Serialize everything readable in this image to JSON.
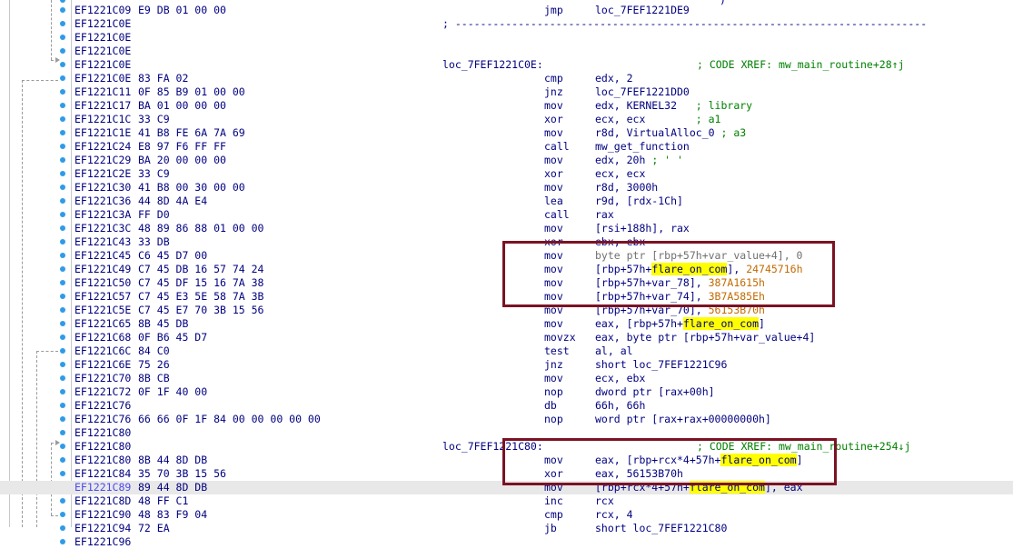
{
  "listing": {
    "top_fragment": {
      "text": ")"
    },
    "rows": [
      {
        "addr": "EF1221C09",
        "bytes": "E9 DB 01 00 00",
        "mnemonic": "jmp",
        "operand": [
          {
            "t": "loc_7FEF1221DE9"
          }
        ]
      },
      {
        "addr": "EF1221C0E",
        "separator": "; ---------------------------------------------------------------------------"
      },
      {
        "addr": "EF1221C0E"
      },
      {
        "addr": "EF1221C0E"
      },
      {
        "addr": "EF1221C0E",
        "label": "loc_7FEF1221C0E:",
        "xref": "; CODE XREF: mw_main_routine+28↑j"
      },
      {
        "addr": "EF1221C0E",
        "bytes": "83 FA 02",
        "mnemonic": "cmp",
        "operand": [
          {
            "t": "edx, 2"
          }
        ]
      },
      {
        "addr": "EF1221C11",
        "bytes": "0F 85 B9 01 00 00",
        "mnemonic": "jnz",
        "operand": [
          {
            "t": "loc_7FEF1221DD0"
          }
        ]
      },
      {
        "addr": "EF1221C17",
        "bytes": "BA 01 00 00 00",
        "mnemonic": "mov",
        "operand": [
          {
            "t": "edx, KERNEL32   "
          },
          {
            "t": "; library",
            "c": "cmt"
          }
        ]
      },
      {
        "addr": "EF1221C1C",
        "bytes": "33 C9",
        "mnemonic": "xor",
        "operand": [
          {
            "t": "ecx, ecx        "
          },
          {
            "t": "; a1",
            "c": "cmt"
          }
        ]
      },
      {
        "addr": "EF1221C1E",
        "bytes": "41 B8 FE 6A 7A 69",
        "mnemonic": "mov",
        "operand": [
          {
            "t": "r8d, VirtualAlloc_0 "
          },
          {
            "t": "; a3",
            "c": "cmt"
          }
        ]
      },
      {
        "addr": "EF1221C24",
        "bytes": "E8 97 F6 FF FF",
        "mnemonic": "call",
        "operand": [
          {
            "t": "mw_get_function"
          }
        ]
      },
      {
        "addr": "EF1221C29",
        "bytes": "BA 20 00 00 00",
        "mnemonic": "mov",
        "operand": [
          {
            "t": "edx, 20h "
          },
          {
            "t": "; ' '",
            "c": "cmt"
          }
        ]
      },
      {
        "addr": "EF1221C2E",
        "bytes": "33 C9",
        "mnemonic": "xor",
        "operand": [
          {
            "t": "ecx, ecx"
          }
        ]
      },
      {
        "addr": "EF1221C30",
        "bytes": "41 B8 00 30 00 00",
        "mnemonic": "mov",
        "operand": [
          {
            "t": "r8d, 3000h"
          }
        ]
      },
      {
        "addr": "EF1221C36",
        "bytes": "44 8D 4A E4",
        "mnemonic": "lea",
        "operand": [
          {
            "t": "r9d, [rdx-1Ch]"
          }
        ]
      },
      {
        "addr": "EF1221C3A",
        "bytes": "FF D0",
        "mnemonic": "call",
        "operand": [
          {
            "t": "rax"
          }
        ]
      },
      {
        "addr": "EF1221C3C",
        "bytes": "48 89 86 88 01 00 00",
        "mnemonic": "mov",
        "operand": [
          {
            "t": "[rsi+188h], rax"
          }
        ]
      },
      {
        "addr": "EF1221C43",
        "bytes": "33 DB",
        "mnemonic": "xor",
        "operand": [
          {
            "t": "ebx, ebx"
          }
        ]
      },
      {
        "addr": "EF1221C45",
        "bytes": "C6 45 D7 00",
        "mnemonic": "mov",
        "operand": [
          {
            "t": "byte ptr [rbp+57h+var_value+4], 0",
            "c": "gray"
          }
        ]
      },
      {
        "addr": "EF1221C49",
        "bytes": "C7 45 DB 16 57 74 24",
        "mnemonic": "mov",
        "operand": [
          {
            "t": "[rbp+57h+"
          },
          {
            "t": "flare_on_com",
            "c": "yel"
          },
          {
            "t": "], "
          },
          {
            "t": "24745716h",
            "c": "imm"
          }
        ]
      },
      {
        "addr": "EF1221C50",
        "bytes": "C7 45 DF 15 16 7A 38",
        "mnemonic": "mov",
        "operand": [
          {
            "t": "[rbp+57h+var_78], "
          },
          {
            "t": "387A1615h",
            "c": "imm"
          }
        ]
      },
      {
        "addr": "EF1221C57",
        "bytes": "C7 45 E3 5E 58 7A 3B",
        "mnemonic": "mov",
        "operand": [
          {
            "t": "[rbp+57h+var_74], "
          },
          {
            "t": "3B7A585Eh",
            "c": "imm"
          }
        ]
      },
      {
        "addr": "EF1221C5E",
        "bytes": "C7 45 E7 70 3B 15 56",
        "mnemonic": "mov",
        "operand": [
          {
            "t": "[rbp+57h+var_70], "
          },
          {
            "t": "56153B70h",
            "c": "imm"
          }
        ]
      },
      {
        "addr": "EF1221C65",
        "bytes": "8B 45 DB",
        "mnemonic": "mov",
        "operand": [
          {
            "t": "eax, [rbp+57h+"
          },
          {
            "t": "flare_on_com",
            "c": "yel"
          },
          {
            "t": "]"
          }
        ]
      },
      {
        "addr": "EF1221C68",
        "bytes": "0F B6 45 D7",
        "mnemonic": "movzx",
        "operand": [
          {
            "t": "eax, byte ptr [rbp+57h+var_value+4]"
          }
        ]
      },
      {
        "addr": "EF1221C6C",
        "bytes": "84 C0",
        "mnemonic": "test",
        "operand": [
          {
            "t": "al, al"
          }
        ]
      },
      {
        "addr": "EF1221C6E",
        "bytes": "75 26",
        "mnemonic": "jnz",
        "operand": [
          {
            "t": "short loc_7FEF1221C96"
          }
        ]
      },
      {
        "addr": "EF1221C70",
        "bytes": "8B CB",
        "mnemonic": "mov",
        "operand": [
          {
            "t": "ecx, ebx"
          }
        ]
      },
      {
        "addr": "EF1221C72",
        "bytes": "0F 1F 40 00",
        "mnemonic": "nop",
        "operand": [
          {
            "t": "dword ptr [rax+00h]"
          }
        ]
      },
      {
        "addr": "EF1221C76",
        "mnemonic": "db",
        "operand": [
          {
            "t": "66h, 66h"
          }
        ]
      },
      {
        "addr": "EF1221C76",
        "bytes": "66 66 0F 1F 84 00 00 00 00 00",
        "mnemonic": "nop",
        "operand": [
          {
            "t": "word ptr [rax+rax+00000000h]"
          }
        ]
      },
      {
        "addr": "EF1221C80"
      },
      {
        "addr": "EF1221C80",
        "label": "loc_7FEF1221C80:",
        "xref": "; CODE XREF: mw_main_routine+254↓j"
      },
      {
        "addr": "EF1221C80",
        "bytes": "8B 44 8D DB",
        "mnemonic": "mov",
        "operand": [
          {
            "t": "eax, [rbp+rcx*4+57h+"
          },
          {
            "t": "flare_on_com",
            "c": "yel"
          },
          {
            "t": "]"
          }
        ]
      },
      {
        "addr": "EF1221C84",
        "bytes": "35 70 3B 15 56",
        "mnemonic": "xor",
        "operand": [
          {
            "t": "eax, 56153B70h"
          }
        ]
      },
      {
        "addr": "EF1221C89",
        "bytes": "89 44 8D DB",
        "mnemonic": "mov",
        "operand": [
          {
            "t": "[rbp+rcx*4+57h+"
          },
          {
            "t": "flare_on_com",
            "c": "yel"
          },
          {
            "t": "], eax"
          }
        ],
        "selected": true
      },
      {
        "addr": "EF1221C8D",
        "bytes": "48 FF C1",
        "mnemonic": "inc",
        "operand": [
          {
            "t": "rcx"
          }
        ]
      },
      {
        "addr": "EF1221C90",
        "bytes": "48 83 F9 04",
        "mnemonic": "cmp",
        "operand": [
          {
            "t": "rcx, 4"
          }
        ]
      },
      {
        "addr": "EF1221C94",
        "bytes": "72 EA",
        "mnemonic": "jb",
        "operand": [
          {
            "t": "short loc_7FEF1221C80"
          }
        ]
      },
      {
        "addr": "EF1221C96"
      }
    ]
  },
  "colors": {
    "address": "#000080",
    "comment": "#008000",
    "immediate": "#c26a00",
    "highlight": "#ffff00",
    "annotation_box": "#7b1324",
    "selected_row": "#e8e8e8"
  },
  "icons": {
    "breakpoint": "breakpoint-dot-icon",
    "flow_arrow": "flow-arrow-icon"
  }
}
